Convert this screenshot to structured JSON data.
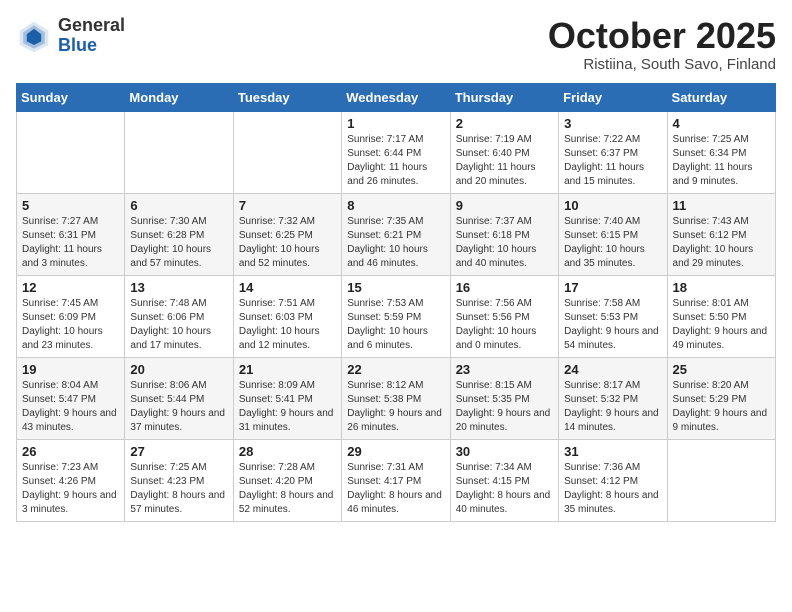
{
  "logo": {
    "general": "General",
    "blue": "Blue"
  },
  "title": "October 2025",
  "subtitle": "Ristiina, South Savo, Finland",
  "days_of_week": [
    "Sunday",
    "Monday",
    "Tuesday",
    "Wednesday",
    "Thursday",
    "Friday",
    "Saturday"
  ],
  "weeks": [
    [
      {
        "day": "",
        "info": ""
      },
      {
        "day": "",
        "info": ""
      },
      {
        "day": "",
        "info": ""
      },
      {
        "day": "1",
        "info": "Sunrise: 7:17 AM\nSunset: 6:44 PM\nDaylight: 11 hours and 26 minutes."
      },
      {
        "day": "2",
        "info": "Sunrise: 7:19 AM\nSunset: 6:40 PM\nDaylight: 11 hours and 20 minutes."
      },
      {
        "day": "3",
        "info": "Sunrise: 7:22 AM\nSunset: 6:37 PM\nDaylight: 11 hours and 15 minutes."
      },
      {
        "day": "4",
        "info": "Sunrise: 7:25 AM\nSunset: 6:34 PM\nDaylight: 11 hours and 9 minutes."
      }
    ],
    [
      {
        "day": "5",
        "info": "Sunrise: 7:27 AM\nSunset: 6:31 PM\nDaylight: 11 hours and 3 minutes."
      },
      {
        "day": "6",
        "info": "Sunrise: 7:30 AM\nSunset: 6:28 PM\nDaylight: 10 hours and 57 minutes."
      },
      {
        "day": "7",
        "info": "Sunrise: 7:32 AM\nSunset: 6:25 PM\nDaylight: 10 hours and 52 minutes."
      },
      {
        "day": "8",
        "info": "Sunrise: 7:35 AM\nSunset: 6:21 PM\nDaylight: 10 hours and 46 minutes."
      },
      {
        "day": "9",
        "info": "Sunrise: 7:37 AM\nSunset: 6:18 PM\nDaylight: 10 hours and 40 minutes."
      },
      {
        "day": "10",
        "info": "Sunrise: 7:40 AM\nSunset: 6:15 PM\nDaylight: 10 hours and 35 minutes."
      },
      {
        "day": "11",
        "info": "Sunrise: 7:43 AM\nSunset: 6:12 PM\nDaylight: 10 hours and 29 minutes."
      }
    ],
    [
      {
        "day": "12",
        "info": "Sunrise: 7:45 AM\nSunset: 6:09 PM\nDaylight: 10 hours and 23 minutes."
      },
      {
        "day": "13",
        "info": "Sunrise: 7:48 AM\nSunset: 6:06 PM\nDaylight: 10 hours and 17 minutes."
      },
      {
        "day": "14",
        "info": "Sunrise: 7:51 AM\nSunset: 6:03 PM\nDaylight: 10 hours and 12 minutes."
      },
      {
        "day": "15",
        "info": "Sunrise: 7:53 AM\nSunset: 5:59 PM\nDaylight: 10 hours and 6 minutes."
      },
      {
        "day": "16",
        "info": "Sunrise: 7:56 AM\nSunset: 5:56 PM\nDaylight: 10 hours and 0 minutes."
      },
      {
        "day": "17",
        "info": "Sunrise: 7:58 AM\nSunset: 5:53 PM\nDaylight: 9 hours and 54 minutes."
      },
      {
        "day": "18",
        "info": "Sunrise: 8:01 AM\nSunset: 5:50 PM\nDaylight: 9 hours and 49 minutes."
      }
    ],
    [
      {
        "day": "19",
        "info": "Sunrise: 8:04 AM\nSunset: 5:47 PM\nDaylight: 9 hours and 43 minutes."
      },
      {
        "day": "20",
        "info": "Sunrise: 8:06 AM\nSunset: 5:44 PM\nDaylight: 9 hours and 37 minutes."
      },
      {
        "day": "21",
        "info": "Sunrise: 8:09 AM\nSunset: 5:41 PM\nDaylight: 9 hours and 31 minutes."
      },
      {
        "day": "22",
        "info": "Sunrise: 8:12 AM\nSunset: 5:38 PM\nDaylight: 9 hours and 26 minutes."
      },
      {
        "day": "23",
        "info": "Sunrise: 8:15 AM\nSunset: 5:35 PM\nDaylight: 9 hours and 20 minutes."
      },
      {
        "day": "24",
        "info": "Sunrise: 8:17 AM\nSunset: 5:32 PM\nDaylight: 9 hours and 14 minutes."
      },
      {
        "day": "25",
        "info": "Sunrise: 8:20 AM\nSunset: 5:29 PM\nDaylight: 9 hours and 9 minutes."
      }
    ],
    [
      {
        "day": "26",
        "info": "Sunrise: 7:23 AM\nSunset: 4:26 PM\nDaylight: 9 hours and 3 minutes."
      },
      {
        "day": "27",
        "info": "Sunrise: 7:25 AM\nSunset: 4:23 PM\nDaylight: 8 hours and 57 minutes."
      },
      {
        "day": "28",
        "info": "Sunrise: 7:28 AM\nSunset: 4:20 PM\nDaylight: 8 hours and 52 minutes."
      },
      {
        "day": "29",
        "info": "Sunrise: 7:31 AM\nSunset: 4:17 PM\nDaylight: 8 hours and 46 minutes."
      },
      {
        "day": "30",
        "info": "Sunrise: 7:34 AM\nSunset: 4:15 PM\nDaylight: 8 hours and 40 minutes."
      },
      {
        "day": "31",
        "info": "Sunrise: 7:36 AM\nSunset: 4:12 PM\nDaylight: 8 hours and 35 minutes."
      },
      {
        "day": "",
        "info": ""
      }
    ]
  ]
}
